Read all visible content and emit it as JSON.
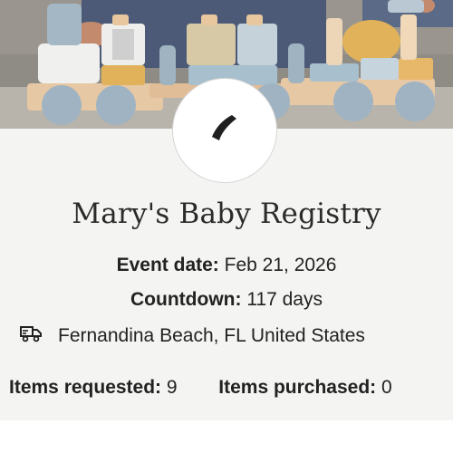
{
  "registry": {
    "title": "Mary's Baby Registry",
    "event_date_label": "Event date:",
    "event_date_value": "Feb 21, 2026",
    "countdown_label": "Countdown:",
    "countdown_value": "117 days",
    "location": "Fernandina Beach, FL United States",
    "items_requested_label": "Items requested:",
    "items_requested_value": "9",
    "items_purchased_label": "Items purchased:",
    "items_purchased_value": "0"
  },
  "icons": {
    "avatar": "registry-logo-icon",
    "location": "delivery-truck-icon"
  },
  "colors": {
    "background": "#f4f4f2",
    "text": "#222222",
    "title": "#2b2b2b",
    "avatar_border": "#d6d6d6"
  }
}
